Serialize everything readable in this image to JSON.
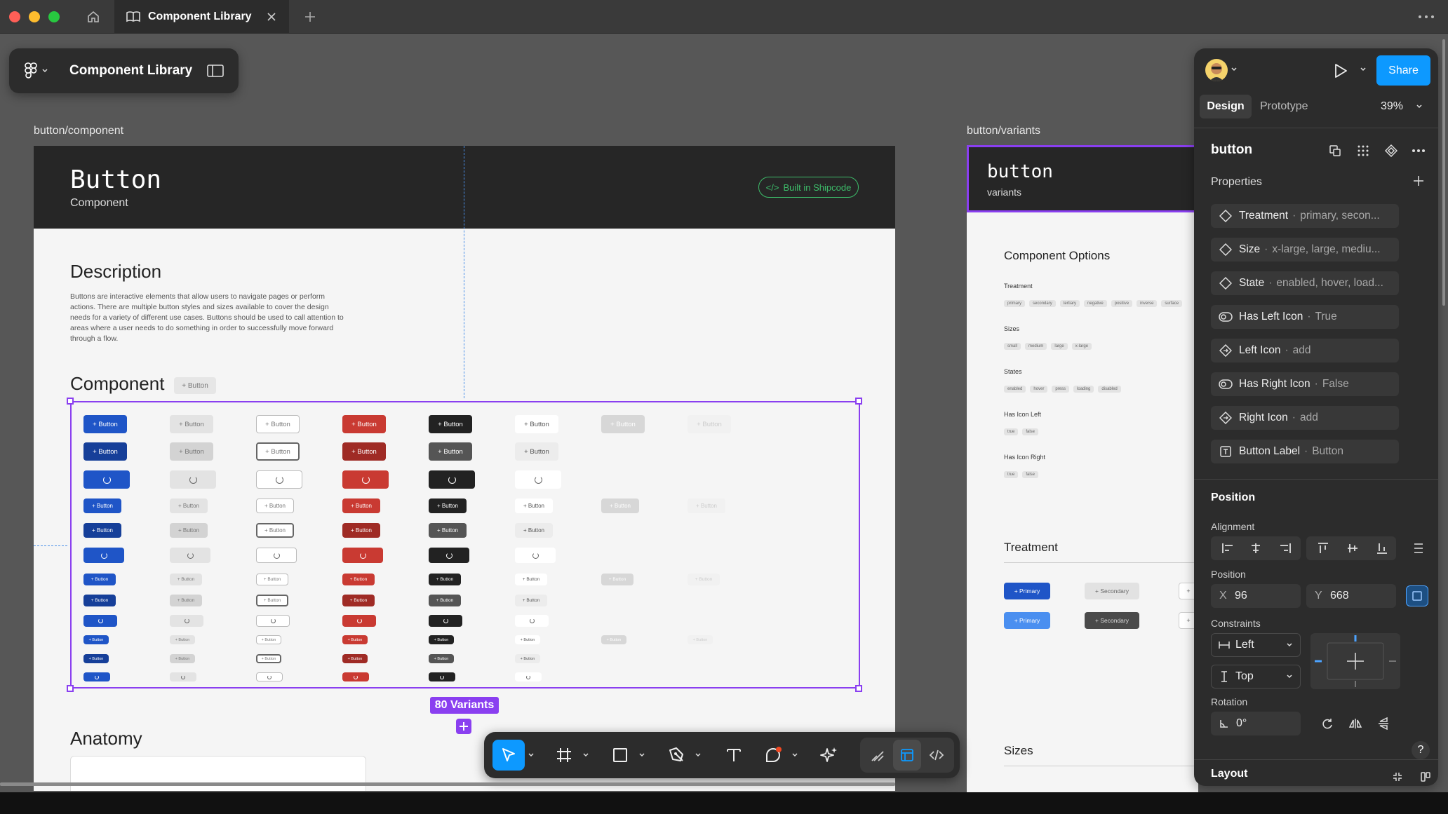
{
  "tab": {
    "title": "Component Library"
  },
  "file": {
    "name": "Component Library"
  },
  "canvas": {
    "frame1_label": "button/component",
    "frame2_label": "button/variants",
    "variants_badge": "80 Variants"
  },
  "doc": {
    "title": "Button",
    "subtitle": "Component",
    "shipcode": "Built in Shipcode",
    "description_heading": "Description",
    "description_lines": [
      "Buttons are interactive elements that allow users to navigate pages or perform",
      "actions. There are multiple button styles and sizes available to cover the design",
      "needs for a variety of different use cases. Buttons should be used to call attention to",
      "areas where a user needs to do something in order to successfully move forward",
      "through a flow."
    ],
    "component_heading": "Component",
    "component_chip": "Button",
    "anatomy_heading": "Anatomy",
    "button_label": "Button"
  },
  "variants_doc": {
    "title": "button",
    "subtitle": "variants",
    "options_heading": "Component Options",
    "groups": [
      {
        "label": "Treatment",
        "chips": [
          "primary",
          "secondary",
          "tertiary",
          "negative",
          "positive",
          "inverse",
          "surface"
        ]
      },
      {
        "label": "Sizes",
        "chips": [
          "small",
          "medium",
          "large",
          "x-large"
        ]
      },
      {
        "label": "States",
        "chips": [
          "enabled",
          "hover",
          "press",
          "loading",
          "disabled"
        ]
      },
      {
        "label": "Has Icon Left",
        "chips": [
          "true",
          "false"
        ]
      },
      {
        "label": "Has Icon Right",
        "chips": [
          "true",
          "false"
        ]
      }
    ],
    "treatment_heading": "Treatment",
    "primary_label": "Primary",
    "secondary_label": "Secondary",
    "sizes_heading": "Sizes"
  },
  "panel": {
    "share": "Share",
    "tabs": [
      "Design",
      "Prototype"
    ],
    "zoom": "39%",
    "layer_name": "button",
    "properties_heading": "Properties",
    "properties": [
      {
        "icon": "variant-icon",
        "name": "Treatment",
        "value": "primary, secon..."
      },
      {
        "icon": "variant-icon",
        "name": "Size",
        "value": "x-large, large, mediu..."
      },
      {
        "icon": "variant-icon",
        "name": "State",
        "value": "enabled, hover, load..."
      },
      {
        "icon": "boolean-icon",
        "name": "Has Left Icon",
        "value": "True"
      },
      {
        "icon": "instance-swap-icon",
        "name": "Left Icon",
        "value": "add"
      },
      {
        "icon": "boolean-icon",
        "name": "Has Right Icon",
        "value": "False"
      },
      {
        "icon": "instance-swap-icon",
        "name": "Right Icon",
        "value": "add"
      },
      {
        "icon": "text-prop-icon",
        "name": "Button Label",
        "value": "Button"
      }
    ],
    "position_heading": "Position",
    "alignment_label": "Alignment",
    "position_label": "Position",
    "x_label": "X",
    "x_value": "96",
    "y_label": "Y",
    "y_value": "668",
    "constraints_label": "Constraints",
    "constraint_h": "Left",
    "constraint_v": "Top",
    "rotation_label": "Rotation",
    "rotation_value": "0°",
    "layout_heading": "Layout",
    "help": "?"
  },
  "colors": {
    "accent": "#0d99ff",
    "selection": "#8a3ff0",
    "primary_btn": "#1f55c7",
    "primary_btn_press": "#163f99",
    "negative_btn": "#c93a32",
    "negative_btn_press": "#9f2b25",
    "inverse_btn": "#222222",
    "shipcode_green": "#3dbd6a"
  }
}
